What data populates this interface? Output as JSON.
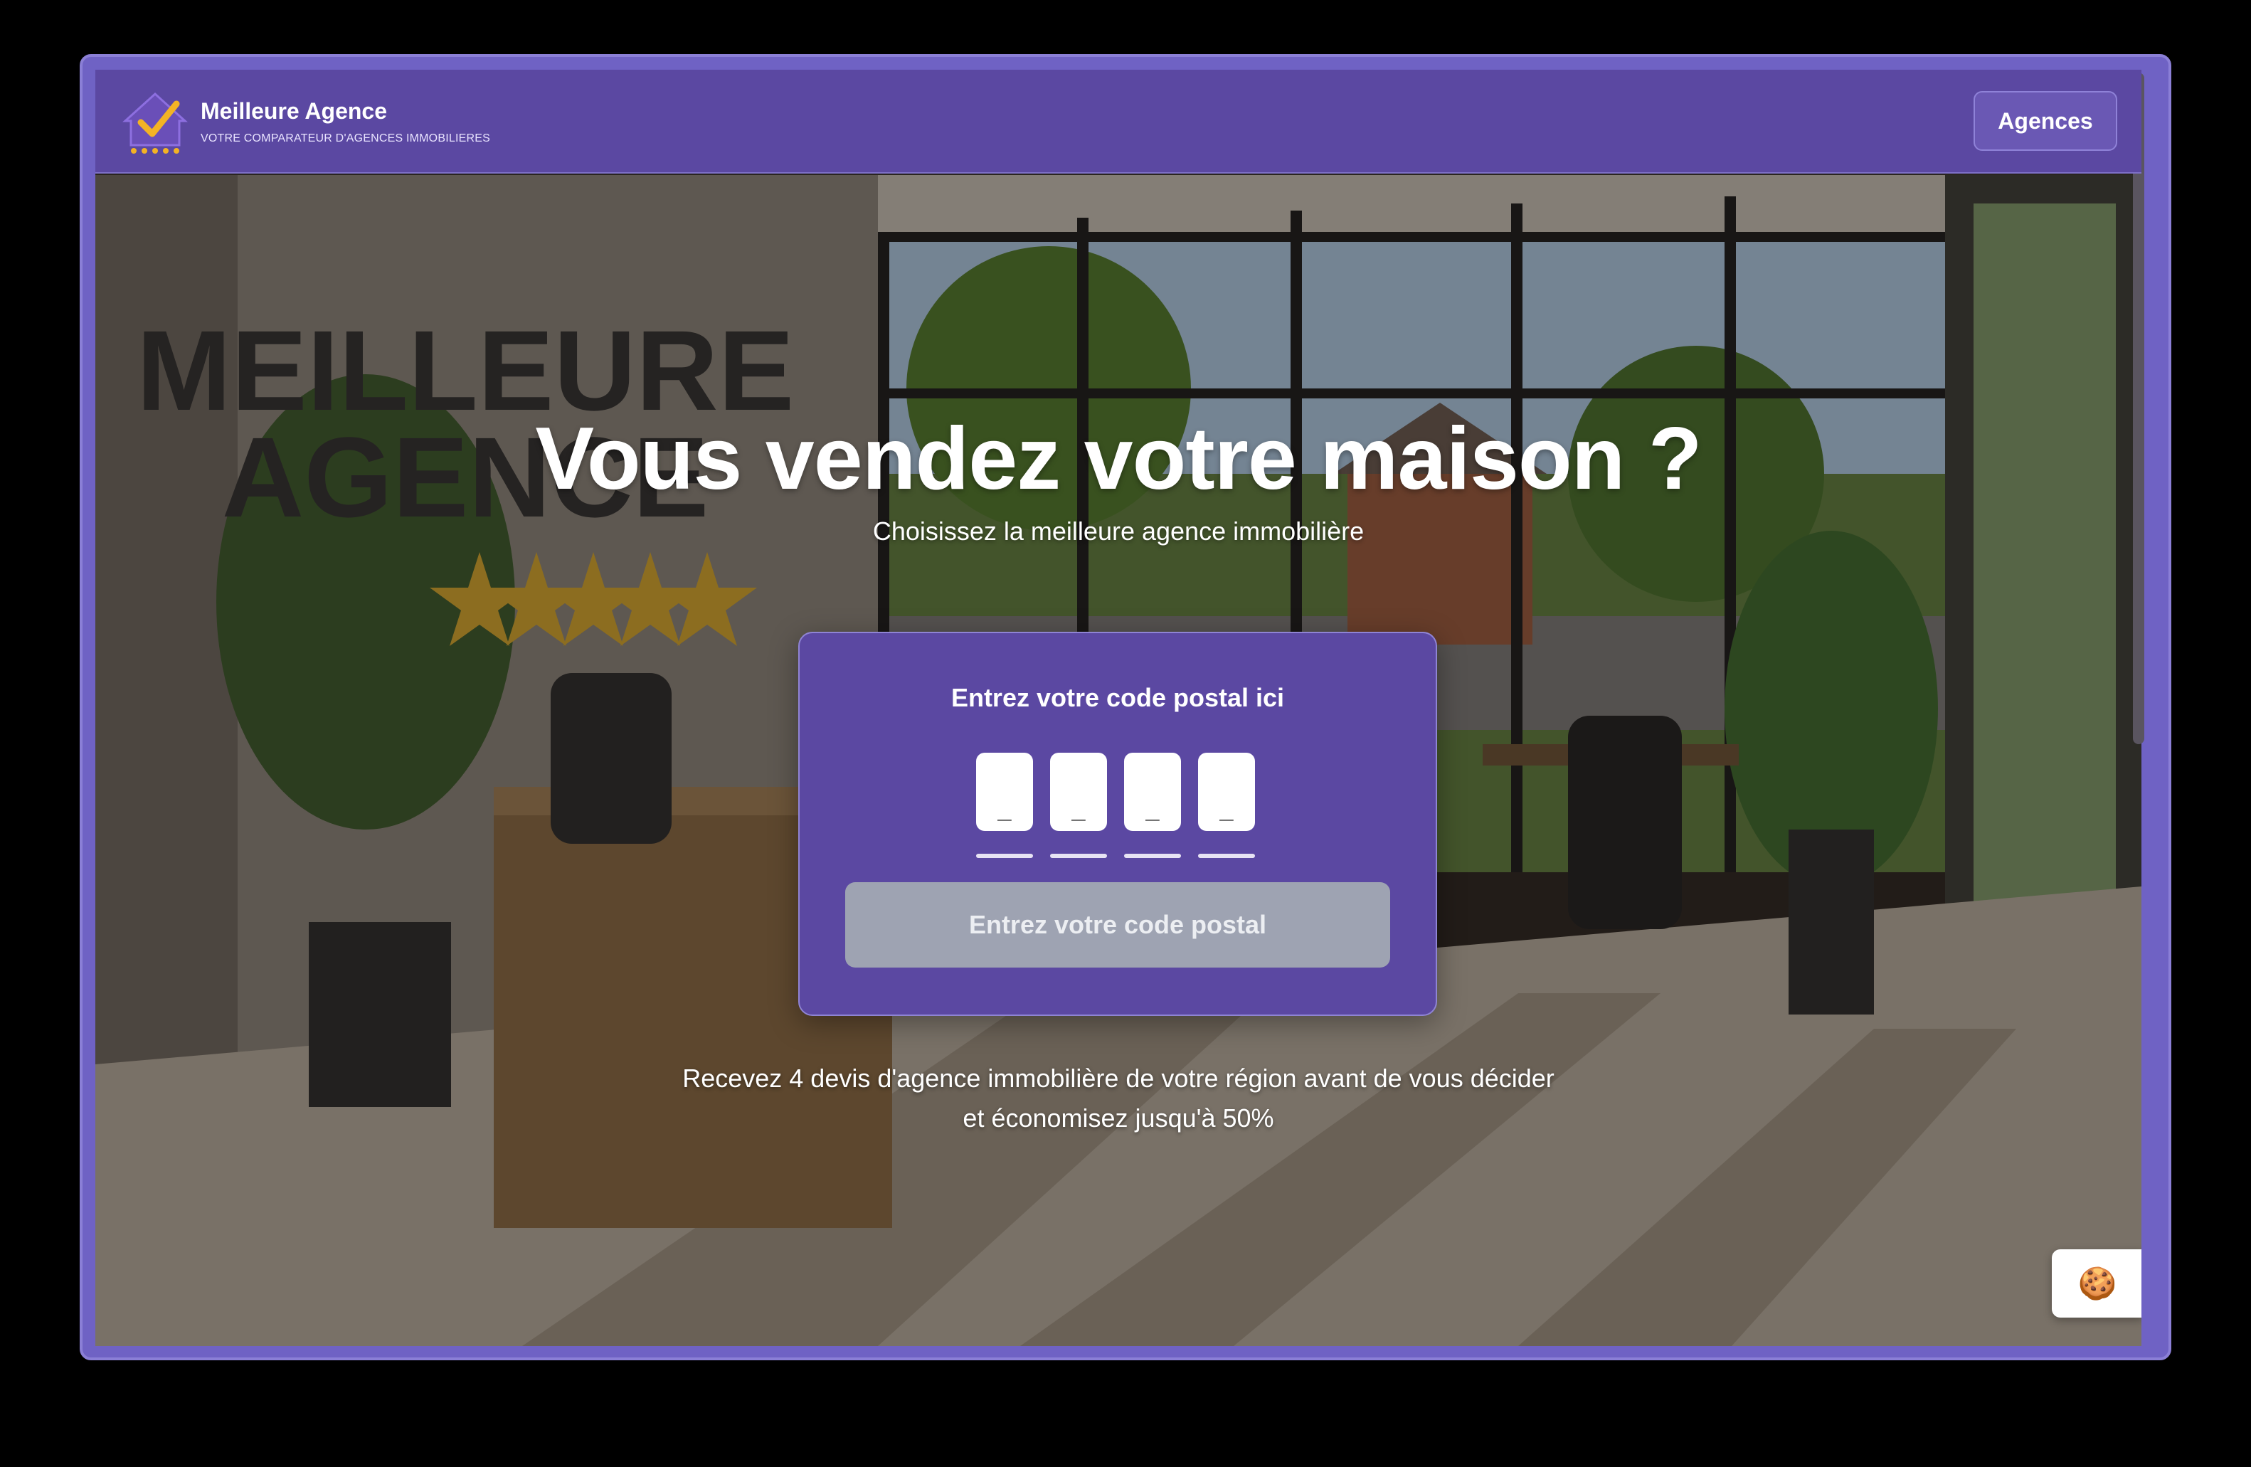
{
  "brand": {
    "name": "Meilleure Agence",
    "tagline": "VOTRE COMPARATEUR D'AGENCES IMMOBILIERES"
  },
  "nav": {
    "agences_label": "Agences"
  },
  "hero": {
    "title": "Vous vendez votre maison ?",
    "subtitle": "Choisissez la meilleure agence immobilière"
  },
  "postal_form": {
    "title": "Entrez votre code postal ici",
    "digits": [
      {
        "placeholder": "_"
      },
      {
        "placeholder": "_"
      },
      {
        "placeholder": "_"
      },
      {
        "placeholder": "_"
      }
    ],
    "submit_label": "Entrez votre code postal"
  },
  "info": {
    "line1": "Recevez 4 devis d'agence immobilière de votre région avant de vous décider",
    "line2": "et économisez jusqu'à 50%"
  },
  "scene_sign": {
    "line1": "MEILLEURE",
    "line2": "AGENCE"
  },
  "cookie": {
    "icon": "🍪"
  },
  "colors": {
    "primary": "#5b48a2",
    "frame": "#6f62c4",
    "button_disabled": "#9ea3b2",
    "star": "#d6a72c"
  }
}
